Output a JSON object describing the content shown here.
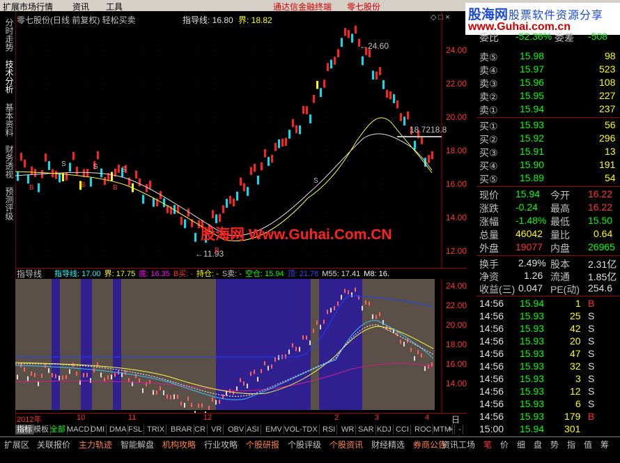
{
  "menu": {
    "items": [
      "扩展市场行情",
      "资讯",
      "工具"
    ],
    "promo1": "通达信金融终端",
    "promo2": "零七股份",
    "window_controls": [
      "◇",
      "□",
      "×"
    ]
  },
  "brand": {
    "name": "股海网",
    "slogan": "股票软件资源分享",
    "url": "www.Guhai.com.cn"
  },
  "left_tabs": [
    "分时走势",
    "技术分析",
    "基本资料",
    "财务透视",
    "预测评级"
  ],
  "top_chart": {
    "title": "零七股份(日线 前复权) 轻松买卖",
    "indicator": "指导线: 16.80",
    "boundary": "界: 18.82",
    "high_label": "24.60",
    "low_label": "11.93",
    "line_label": "18.72",
    "line_label_cut": "18.8",
    "y_ticks": [
      "24.00",
      "22.00",
      "20.00",
      "18.00",
      "16.00",
      "14.00",
      "12.00"
    ],
    "markers": [
      "S",
      "B"
    ]
  },
  "bottom_chart": {
    "name": "指导线",
    "legend": [
      {
        "text": "指导线: 17.00",
        "color": "#00ffff"
      },
      {
        "text": "界: 17.75",
        "color": "#ffff00"
      },
      {
        "text": "底: 16.35",
        "color": "#ff00ff"
      },
      {
        "text": "B买: -",
        "color": "#ff3030"
      },
      {
        "text": "持仓: -",
        "color": "#ffff00"
      },
      {
        "text": "S卖: -",
        "color": "#c0c0c0"
      },
      {
        "text": "空仓: 15.94",
        "color": "#00ff00"
      },
      {
        "text": "顶: 21.78",
        "color": "#4040ff"
      },
      {
        "text": "M55: 17.41",
        "color": "#e0e0e0"
      },
      {
        "text": "M8: 16.",
        "color": "#ffffff"
      }
    ],
    "y_ticks": [
      "24.00",
      "22.00",
      "20.00",
      "18.00",
      "16.00",
      "14.00"
    ]
  },
  "x_axis": {
    "labels": [
      "2012年",
      "10",
      "11",
      "12",
      "2",
      "3",
      "4"
    ],
    "period": "日线"
  },
  "indicator_tabs": [
    "指标",
    "模板",
    "全部",
    "MACD",
    "DMI",
    "DMA",
    "FSL",
    "TRIX",
    "BRAR",
    "CR",
    "VR",
    "OBV",
    "ASI",
    "EMV",
    "VOL-TDX",
    "RSI",
    "WR",
    "SAR",
    "KDJ",
    "CCI",
    "ROC",
    "MTM"
  ],
  "tab_controls": [
    "+",
    "-"
  ],
  "bottom_bar": [
    "扩展区",
    "关联报价",
    "主力轨迹",
    "智能解盘",
    "机构攻略",
    "行业攻略",
    "个股研报",
    "个股评级",
    "个股资讯",
    "财经精选",
    "券商公告",
    "资讯工场"
  ],
  "right_bottom_tabs": [
    "笔",
    "价",
    "细",
    "盘",
    "势",
    "指",
    "值",
    "筹"
  ],
  "order_book": {
    "partial": {
      "label": "委比",
      "value": "-52.36%",
      "label2": "委差",
      "value2": "-508"
    },
    "asks": [
      {
        "label": "卖⑤",
        "price": "15.98",
        "vol": "98"
      },
      {
        "label": "卖④",
        "price": "15.97",
        "vol": "523"
      },
      {
        "label": "卖③",
        "price": "15.96",
        "vol": "108"
      },
      {
        "label": "卖②",
        "price": "15.95",
        "vol": "227"
      },
      {
        "label": "卖①",
        "price": "15.94",
        "vol": "237"
      }
    ],
    "bids": [
      {
        "label": "买①",
        "price": "15.93",
        "vol": "56"
      },
      {
        "label": "买②",
        "price": "15.92",
        "vol": "296"
      },
      {
        "label": "买③",
        "price": "15.91",
        "vol": "13"
      },
      {
        "label": "买④",
        "price": "15.90",
        "vol": "191"
      },
      {
        "label": "买⑤",
        "price": "15.89",
        "vol": "54"
      }
    ]
  },
  "quote": [
    {
      "l1": "现价",
      "v1": "15.94",
      "c1": "g",
      "l2": "今开",
      "v2": "16.22",
      "c2": "r"
    },
    {
      "l1": "涨跌",
      "v1": "-0.24",
      "c1": "g",
      "l2": "最高",
      "v2": "16.22",
      "c2": "r"
    },
    {
      "l1": "涨幅",
      "v1": "-1.48%",
      "c1": "g",
      "l2": "最低",
      "v2": "15.50",
      "c2": "g"
    },
    {
      "l1": "总量",
      "v1": "46042",
      "c1": "y",
      "l2": "量比",
      "v2": "0.64",
      "c2": "y"
    },
    {
      "l1": "外盘",
      "v1": "19077",
      "c1": "r",
      "l2": "内盘",
      "v2": "26965",
      "c2": "g"
    }
  ],
  "fundamentals": [
    {
      "l1": "换手",
      "v1": "2.49%",
      "l2": "股本",
      "v2": "2.31亿"
    },
    {
      "l1": "净资",
      "v1": "1.26",
      "l2": "流通",
      "v2": "1.85亿"
    },
    {
      "l1": "收益(三)",
      "v1": "0.047",
      "l2": "PE(动)",
      "v2": "254.6"
    }
  ],
  "ticks": [
    {
      "t": "14:56",
      "p": "15.94",
      "v": "1",
      "s": "B"
    },
    {
      "t": "14:56",
      "p": "15.93",
      "v": "25",
      "s": "S"
    },
    {
      "t": "14:56",
      "p": "15.93",
      "v": "42",
      "s": "S"
    },
    {
      "t": "14:56",
      "p": "15.93",
      "v": "20",
      "s": "S"
    },
    {
      "t": "14:56",
      "p": "15.93",
      "v": "47",
      "s": "S"
    },
    {
      "t": "14:56",
      "p": "15.93",
      "v": "32",
      "s": "S"
    },
    {
      "t": "14:56",
      "p": "15.93",
      "v": "3",
      "s": "S"
    },
    {
      "t": "14:56",
      "p": "15.93",
      "v": "12",
      "s": "S"
    },
    {
      "t": "14:56",
      "p": "15.93",
      "v": "6",
      "s": "S"
    },
    {
      "t": "14:56",
      "p": "15.93",
      "v": "179",
      "s": "B"
    },
    {
      "t": "15:00",
      "p": "15.94",
      "v": "301",
      "s": ""
    }
  ],
  "watermark": "股海网 Www.Guhai.Com.CN"
}
